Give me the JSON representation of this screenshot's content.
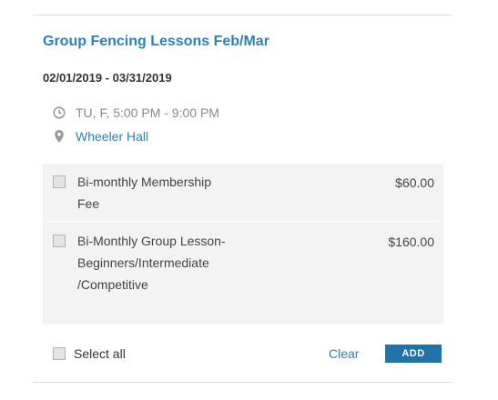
{
  "event": {
    "title": "Group Fencing Lessons Feb/Mar",
    "date_range": "02/01/2019 - 03/31/2019",
    "schedule": "TU, F, 5:00 PM - 9:00 PM",
    "location": "Wheeler Hall",
    "schedule_icon": "clock-icon",
    "location_icon": "map-pin-icon"
  },
  "items": [
    {
      "name": "Bi-monthly Membership Fee",
      "price": "$60.00",
      "checked": false
    },
    {
      "name": "Bi-Monthly Group Lesson-Beginners/Intermediate /Competitive",
      "price": "$160.00",
      "checked": false
    }
  ],
  "footer": {
    "select_all_label": "Select all",
    "clear_label": "Clear",
    "add_label": "ADD"
  },
  "colors": {
    "accent": "#2b82b8",
    "button": "#2072a8",
    "item_background": "#f3f3f3"
  }
}
